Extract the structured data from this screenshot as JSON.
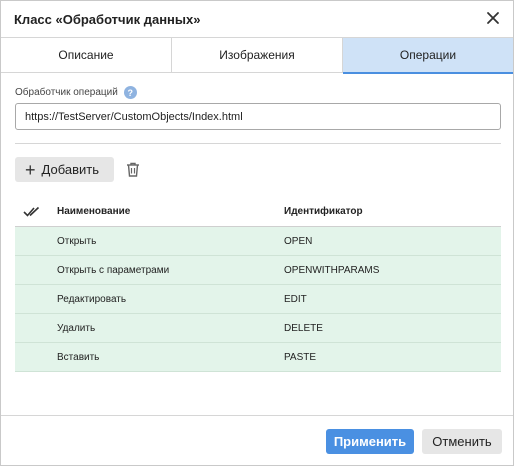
{
  "dialog": {
    "title": "Класс «Обработчик данных»",
    "close_icon": "close-icon"
  },
  "tabs": [
    {
      "label": "Описание",
      "active": false
    },
    {
      "label": "Изображения",
      "active": false
    },
    {
      "label": "Операции",
      "active": true
    }
  ],
  "handler": {
    "label": "Обработчик операций",
    "help_icon": "?",
    "value": "https://TestServer/CustomObjects/Index.html"
  },
  "toolbar": {
    "add_icon": "+",
    "add_label": "Добавить",
    "delete_icon": "trash-icon"
  },
  "table": {
    "check_all_icon": "double-check-icon",
    "headers": {
      "name": "Наименование",
      "id": "Идентификатор"
    },
    "rows": [
      {
        "name": "Открыть",
        "id": "OPEN"
      },
      {
        "name": "Открыть с параметрами",
        "id": "OPENWITHPARAMS"
      },
      {
        "name": "Редактировать",
        "id": "EDIT"
      },
      {
        "name": "Удалить",
        "id": "DELETE"
      },
      {
        "name": "Вставить",
        "id": "PASTE"
      }
    ]
  },
  "footer": {
    "apply_label": "Применить",
    "cancel_label": "Отменить"
  },
  "colors": {
    "accent": "#4a90e2",
    "active_tab": "#cfe2f7",
    "row_selected": "#e3f4ea"
  }
}
